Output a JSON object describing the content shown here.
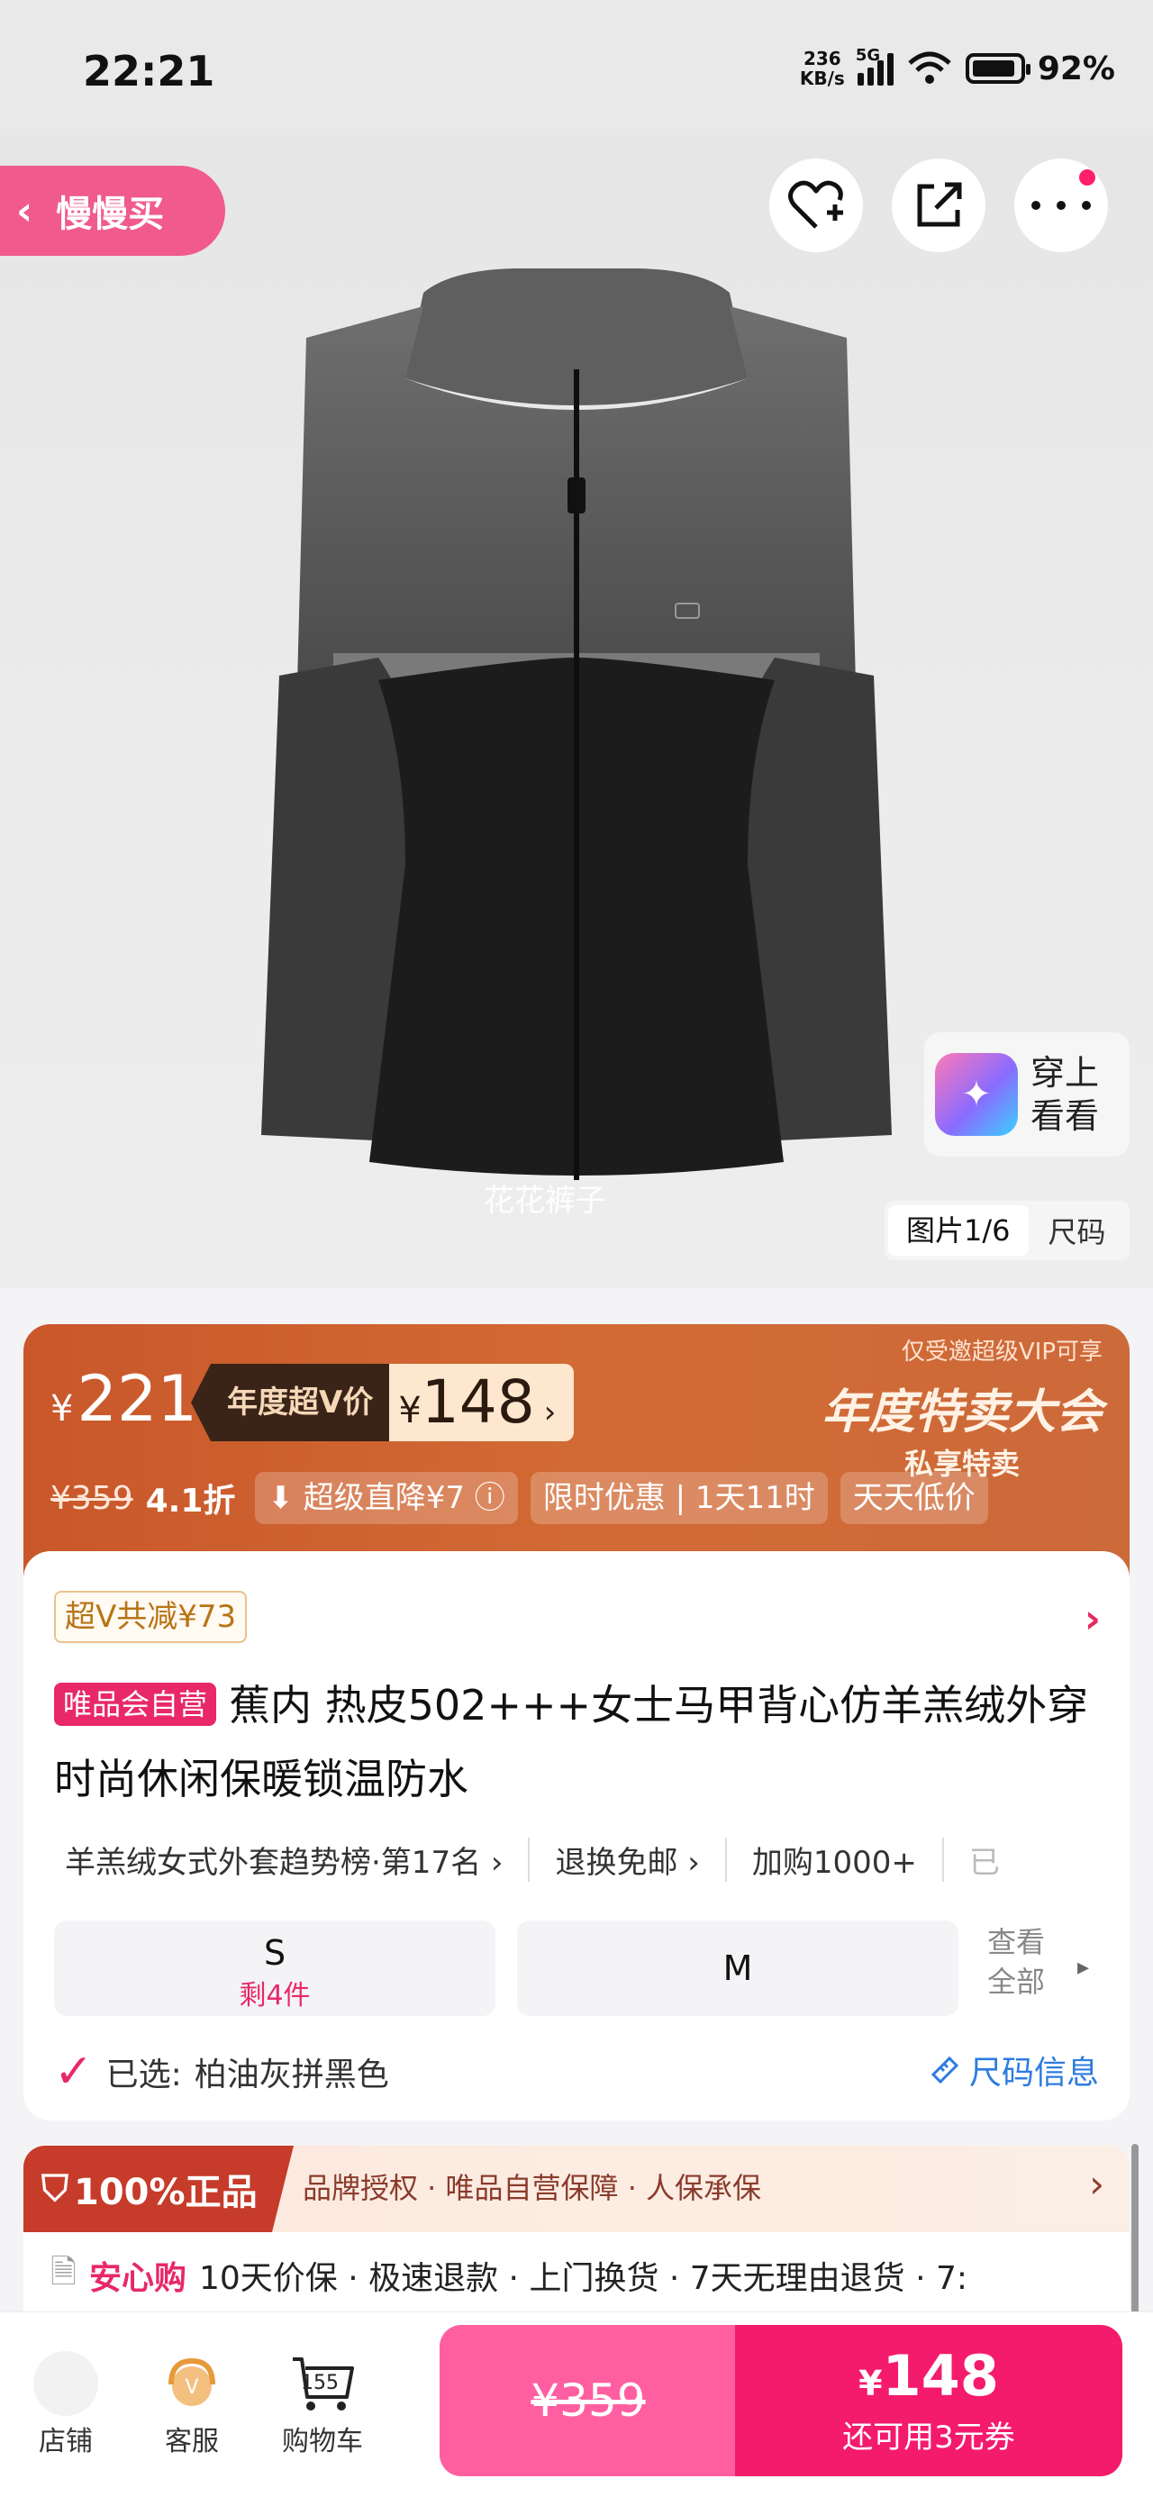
{
  "status": {
    "time": "22:21",
    "net_speed_value": "236",
    "net_speed_unit": "KB/s",
    "signal_label": "5G",
    "battery_pct": "92%",
    "battery_level": 0.92
  },
  "nav": {
    "back_label": "慢慢买"
  },
  "hero": {
    "watermark": "花花裤子",
    "tryon_line1": "穿上",
    "tryon_line2": "看看",
    "pager_index": "图片1/6",
    "pager_size": "尺码"
  },
  "promo": {
    "currency": "¥",
    "price": "221",
    "vip_label": "年度超V价",
    "vip_price": "148",
    "arrow": "›",
    "invite_note": "仅受邀超级VIP可享",
    "event_title": "年度特卖大会",
    "event_sub": "私享特卖",
    "original_price": "¥359",
    "discount": "4.1折",
    "chips": [
      "超级直降¥7 ⓘ",
      "限时优惠 | 1天11时",
      "天天低价"
    ]
  },
  "card": {
    "save_tag": "超Ⅴ共减¥73",
    "self_tag": "唯品会自营",
    "title": "蕉内 热皮502+++女士马甲背心仿羊羔绒外穿时尚休闲保暖锁温防水",
    "meta": [
      "羊羔绒女式外套趋势榜·第17名 ›",
      "退换免邮 ›",
      "加购1000+",
      "已"
    ],
    "sizes": [
      {
        "label": "S",
        "stock": "剩4件"
      },
      {
        "label": "M",
        "stock": ""
      }
    ],
    "see_all_line1": "查看",
    "see_all_line2": "全部",
    "selected_prefix": "已选:",
    "selected_value": "柏油灰拼黑色",
    "size_info": "尺码信息"
  },
  "guarantee": {
    "lead": "100%正品",
    "text": "品牌授权 · 唯品自营保障 · 人保承保",
    "secure_label": "安心购",
    "secure_text": "10天价保 · 极速退款 · 上门换货 · 7天无理由退货 · 7:"
  },
  "bottom": {
    "store_label": "店铺",
    "service_label": "客服",
    "cart_label": "购物车",
    "cart_count": "155",
    "orig_price": "¥359",
    "buy_currency": "¥",
    "buy_price": "148",
    "coupon_text": "还可用3元券"
  },
  "colors": {
    "accent": "#f41a6c",
    "promo": "#c9572a",
    "link": "#2d7ce0"
  }
}
